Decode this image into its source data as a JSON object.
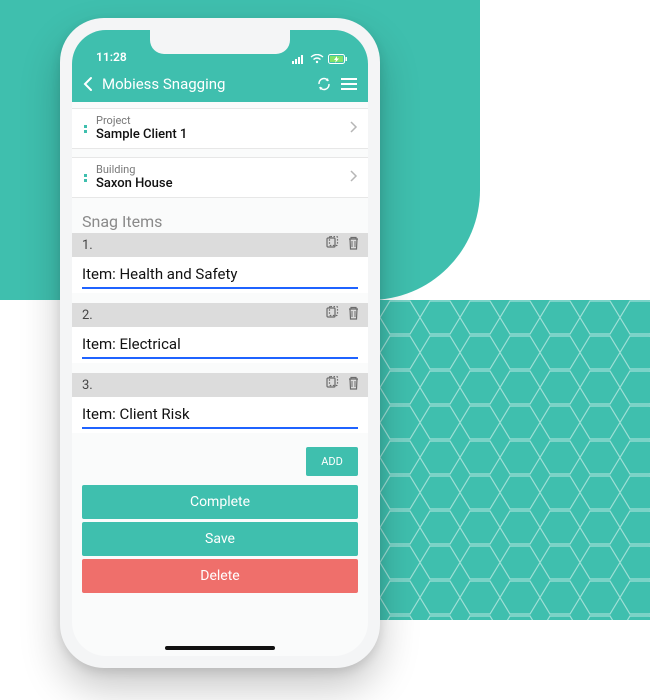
{
  "status_bar": {
    "time": "11:28"
  },
  "header": {
    "title": "Mobiess Snagging"
  },
  "project": {
    "label": "Project",
    "value": "Sample Client 1"
  },
  "building": {
    "label": "Building",
    "value": "Saxon House"
  },
  "section_title": "Snag Items",
  "snags": [
    {
      "num": "1.",
      "text": "Item: Health and Safety"
    },
    {
      "num": "2.",
      "text": "Item: Electrical"
    },
    {
      "num": "3.",
      "text": "Item: Client Risk"
    }
  ],
  "buttons": {
    "add": "ADD",
    "complete": "Complete",
    "save": "Save",
    "delete": "Delete"
  },
  "colors": {
    "accent": "#3fbfae",
    "danger": "#ef6f6b",
    "link": "#1f63ff"
  }
}
